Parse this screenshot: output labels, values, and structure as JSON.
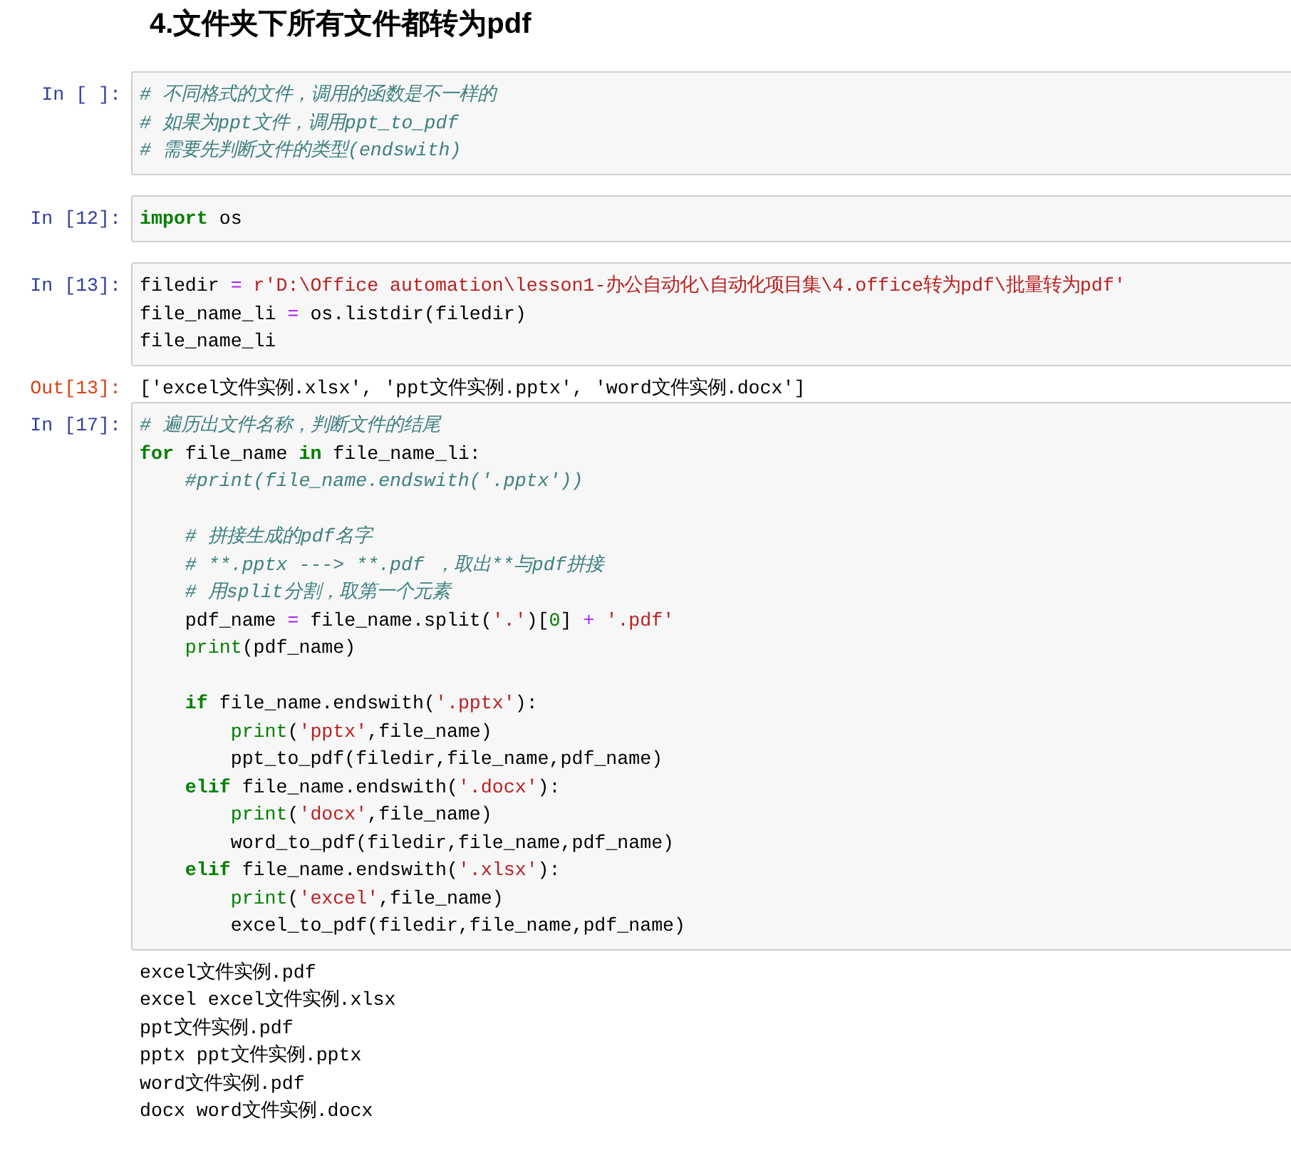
{
  "heading": "4.文件夹下所有文件都转为pdf",
  "cells": [
    {
      "prompt": "In [ ]:",
      "lines": [
        {
          "tokens": [
            {
              "kind": "cm",
              "text": "# 不同格式的文件，调用的函数是不一样的"
            }
          ]
        },
        {
          "tokens": [
            {
              "kind": "cm",
              "text": "# 如果为ppt文件，调用ppt_to_pdf"
            }
          ]
        },
        {
          "tokens": [
            {
              "kind": "cm",
              "text": "# 需要先判断文件的类型(endswith)"
            }
          ]
        }
      ]
    },
    {
      "prompt": "In [12]:",
      "lines": [
        {
          "tokens": [
            {
              "kind": "kw",
              "text": "import"
            },
            {
              "kind": "txt",
              "text": " os"
            }
          ]
        }
      ]
    },
    {
      "prompt": "In [13]:",
      "lines": [
        {
          "tokens": [
            {
              "kind": "txt",
              "text": "filedir "
            },
            {
              "kind": "op",
              "text": "="
            },
            {
              "kind": "str",
              "text": " r'D:\\Office automation\\lesson1-办公自动化\\自动化项目集\\4.office转为pdf\\批量转为pdf'"
            }
          ]
        },
        {
          "tokens": [
            {
              "kind": "txt",
              "text": "file_name_li "
            },
            {
              "kind": "op",
              "text": "="
            },
            {
              "kind": "txt",
              "text": " os.listdir(filedir)"
            }
          ]
        },
        {
          "tokens": [
            {
              "kind": "txt",
              "text": "file_name_li"
            }
          ]
        }
      ],
      "output": {
        "prompt": "Out[13]:",
        "lines": [
          "['excel文件实例.xlsx', 'ppt文件实例.pptx', 'word文件实例.docx']"
        ]
      }
    },
    {
      "prompt": "In [17]:",
      "lines": [
        {
          "tokens": [
            {
              "kind": "cm",
              "text": "# 遍历出文件名称，判断文件的结尾"
            }
          ]
        },
        {
          "tokens": [
            {
              "kind": "kw",
              "text": "for"
            },
            {
              "kind": "txt",
              "text": " file_name "
            },
            {
              "kind": "kw",
              "text": "in"
            },
            {
              "kind": "txt",
              "text": " file_name_li:"
            }
          ]
        },
        {
          "tokens": [
            {
              "kind": "cm",
              "text": "    #print(file_name.endswith('.pptx'))"
            }
          ]
        },
        {
          "blank_before": true,
          "tokens": [
            {
              "kind": "cm",
              "text": "    # 拼接生成的pdf名字"
            }
          ]
        },
        {
          "tokens": [
            {
              "kind": "cm",
              "text": "    # **.pptx ---> **.pdf ，取出**与pdf拼接"
            }
          ]
        },
        {
          "tokens": [
            {
              "kind": "cm",
              "text": "    # 用split分割，取第一个元素"
            }
          ]
        },
        {
          "tokens": [
            {
              "kind": "txt",
              "text": "    pdf_name "
            },
            {
              "kind": "op",
              "text": "="
            },
            {
              "kind": "txt",
              "text": " file_name.split("
            },
            {
              "kind": "str",
              "text": "'.'"
            },
            {
              "kind": "txt",
              "text": ")["
            },
            {
              "kind": "num",
              "text": "0"
            },
            {
              "kind": "txt",
              "text": "] "
            },
            {
              "kind": "op",
              "text": "+"
            },
            {
              "kind": "str",
              "text": " '.pdf'"
            }
          ]
        },
        {
          "tokens": [
            {
              "kind": "bi",
              "text": "    print"
            },
            {
              "kind": "txt",
              "text": "(pdf_name)"
            }
          ]
        },
        {
          "blank_before": true,
          "tokens": [
            {
              "kind": "kw",
              "text": "    if"
            },
            {
              "kind": "txt",
              "text": " file_name.endswith("
            },
            {
              "kind": "str",
              "text": "'.pptx'"
            },
            {
              "kind": "txt",
              "text": "):"
            }
          ]
        },
        {
          "tokens": [
            {
              "kind": "bi",
              "text": "        print"
            },
            {
              "kind": "txt",
              "text": "("
            },
            {
              "kind": "str",
              "text": "'pptx'"
            },
            {
              "kind": "txt",
              "text": ",file_name)"
            }
          ]
        },
        {
          "tokens": [
            {
              "kind": "txt",
              "text": "        ppt_to_pdf(filedir,file_name,pdf_name)"
            }
          ]
        },
        {
          "tokens": [
            {
              "kind": "kw",
              "text": "    elif"
            },
            {
              "kind": "txt",
              "text": " file_name.endswith("
            },
            {
              "kind": "str",
              "text": "'.docx'"
            },
            {
              "kind": "txt",
              "text": "):"
            }
          ]
        },
        {
          "tokens": [
            {
              "kind": "bi",
              "text": "        print"
            },
            {
              "kind": "txt",
              "text": "("
            },
            {
              "kind": "str",
              "text": "'docx'"
            },
            {
              "kind": "txt",
              "text": ",file_name)"
            }
          ]
        },
        {
          "tokens": [
            {
              "kind": "txt",
              "text": "        word_to_pdf(filedir,file_name,pdf_name)"
            }
          ]
        },
        {
          "tokens": [
            {
              "kind": "kw",
              "text": "    elif"
            },
            {
              "kind": "txt",
              "text": " file_name.endswith("
            },
            {
              "kind": "str",
              "text": "'.xlsx'"
            },
            {
              "kind": "txt",
              "text": "):"
            }
          ]
        },
        {
          "tokens": [
            {
              "kind": "bi",
              "text": "        print"
            },
            {
              "kind": "txt",
              "text": "("
            },
            {
              "kind": "str",
              "text": "'excel'"
            },
            {
              "kind": "txt",
              "text": ",file_name)"
            }
          ]
        },
        {
          "tokens": [
            {
              "kind": "txt",
              "text": "        excel_to_pdf(filedir,file_name,pdf_name)"
            }
          ]
        }
      ],
      "output": {
        "lines": [
          "excel文件实例.pdf",
          "excel excel文件实例.xlsx",
          "ppt文件实例.pdf",
          "pptx ppt文件实例.pptx",
          "word文件实例.pdf",
          "docx word文件实例.docx"
        ]
      }
    }
  ]
}
